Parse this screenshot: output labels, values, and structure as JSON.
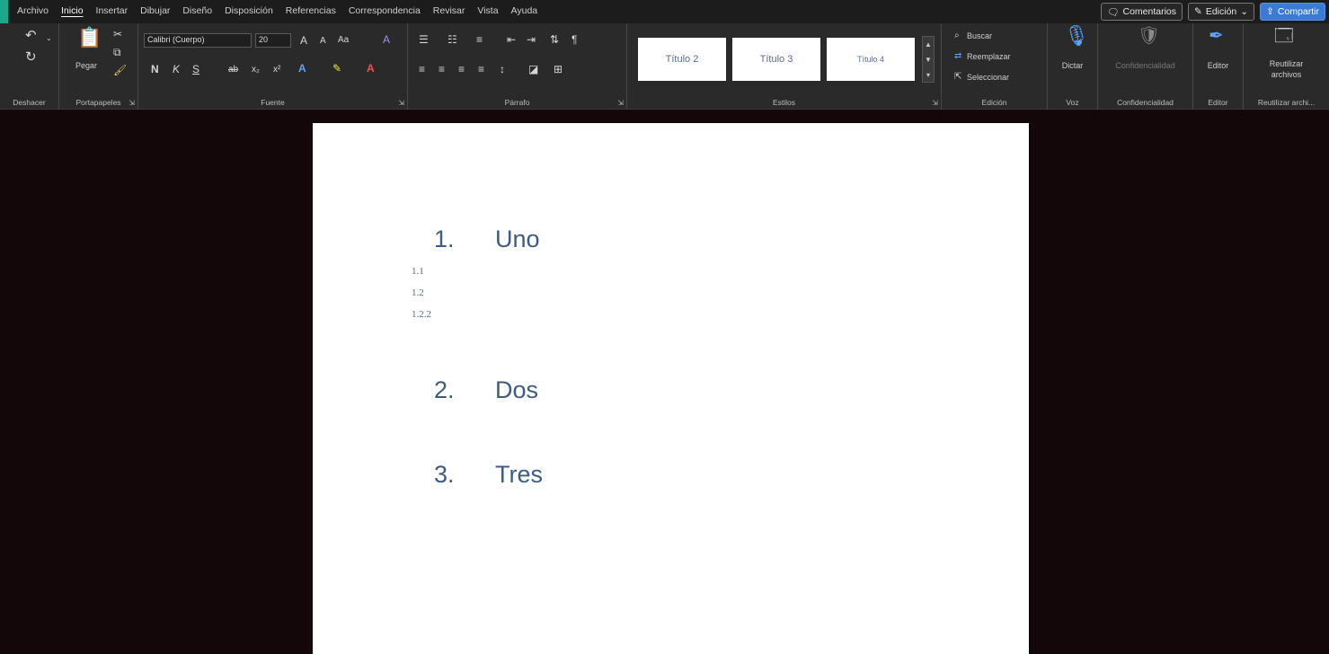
{
  "menu": {
    "tabs": [
      "Archivo",
      "Inicio",
      "Insertar",
      "Dibujar",
      "Diseño",
      "Disposición",
      "Referencias",
      "Correspondencia",
      "Revisar",
      "Vista",
      "Ayuda"
    ],
    "active_tab": "Inicio",
    "comments_label": "Comentarios",
    "editing_label": "Edición",
    "share_label": "Compartir"
  },
  "ribbon": {
    "undo": {
      "label": "Deshacer"
    },
    "clipboard": {
      "paste_label": "Pegar",
      "label": "Portapapeles"
    },
    "font": {
      "name": "Calibri (Cuerpo)",
      "size": "20",
      "label": "Fuente",
      "buttons": [
        "N",
        "K",
        "S",
        "ab",
        "x₂",
        "x²"
      ]
    },
    "paragraph": {
      "label": "Párrafo"
    },
    "styles": {
      "items": [
        "Título 2",
        "Título 3",
        "Título 4"
      ],
      "label": "Estilos"
    },
    "editing": {
      "find": "Buscar",
      "replace": "Reemplazar",
      "select": "Seleccionar",
      "label": "Edición"
    },
    "voice": {
      "dictate": "Dictar",
      "label": "Voz"
    },
    "sensitivity": {
      "button": "Confidencialidad",
      "label": "Confidencialidad"
    },
    "editor": {
      "button": "Editor",
      "label": "Editor"
    },
    "reuse": {
      "button_line1": "Reutilizar",
      "button_line2": "archivos",
      "label": "Reutilizar archi..."
    }
  },
  "document": {
    "items": [
      {
        "number": "1.",
        "text": "Uno"
      },
      {
        "number": "2.",
        "text": "Dos"
      },
      {
        "number": "3.",
        "text": "Tres"
      }
    ],
    "subitems": [
      "1.1",
      "1.2",
      "1.2.2"
    ]
  },
  "colors": {
    "accent": "#1aa88a",
    "share_button": "#3b7bd6",
    "heading_text": "#3e5b82",
    "background": "#140709"
  }
}
